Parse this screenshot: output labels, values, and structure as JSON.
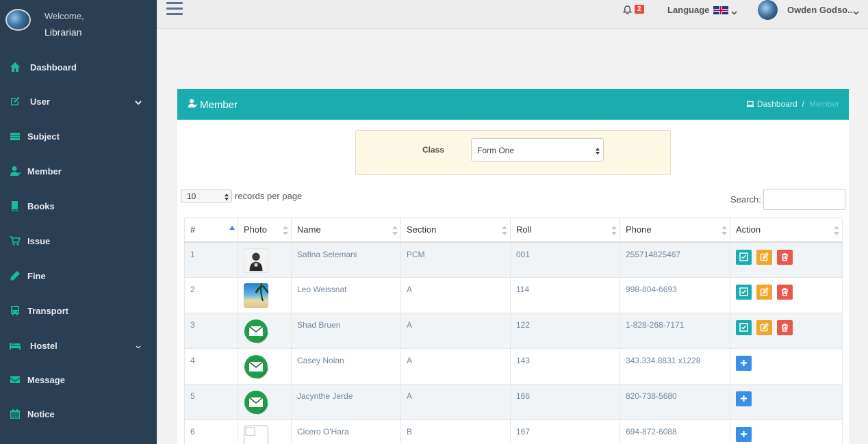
{
  "sidebar": {
    "welcome": "Welcome,",
    "role": "Librarian",
    "items": [
      {
        "label": "Dashboard",
        "icon": "home-icon"
      },
      {
        "label": "User",
        "icon": "edit-icon"
      },
      {
        "label": "Subject",
        "icon": "database-icon"
      },
      {
        "label": "Member",
        "icon": "user-icon"
      },
      {
        "label": "Books",
        "icon": "book-icon"
      },
      {
        "label": "Issue",
        "icon": "cart-icon"
      },
      {
        "label": "Fine",
        "icon": "pen-icon"
      },
      {
        "label": "Transport",
        "icon": "bus-icon"
      },
      {
        "label": "Hostel",
        "icon": "bed-icon"
      },
      {
        "label": "Message",
        "icon": "envelope-icon"
      },
      {
        "label": "Notice",
        "icon": "calendar-icon"
      }
    ]
  },
  "topbar": {
    "notification_count": "2",
    "language_label": "Language",
    "user_name": "Owden Godso.."
  },
  "panel": {
    "title": "Member",
    "breadcrumb": {
      "home": "Dashboard",
      "separator": "/",
      "current": "Member"
    },
    "filter": {
      "label": "Class",
      "selected": "Form One"
    },
    "records_per_page": {
      "value": "10",
      "label": "records per page"
    },
    "search_label": "Search:",
    "columns": [
      "#",
      "Photo",
      "Name",
      "Section",
      "Roll",
      "Phone",
      "Action"
    ],
    "rows": [
      {
        "num": "1",
        "photo": "person",
        "name": "Safina Selemani",
        "section": "PCM",
        "roll": "001",
        "phone": "255714825467",
        "actions": "full"
      },
      {
        "num": "2",
        "photo": "beach",
        "name": "Leo Weissnat",
        "section": "A",
        "roll": "114",
        "phone": "998-804-6693",
        "actions": "full"
      },
      {
        "num": "3",
        "photo": "mail",
        "name": "Shad Bruen",
        "section": "A",
        "roll": "122",
        "phone": "1-828-268-7171",
        "actions": "full"
      },
      {
        "num": "4",
        "photo": "mail",
        "name": "Casey Nolan",
        "section": "A",
        "roll": "143",
        "phone": "343.334.8831 x1228",
        "actions": "add"
      },
      {
        "num": "5",
        "photo": "mail",
        "name": "Jacynthe Jerde",
        "section": "A",
        "roll": "166",
        "phone": "820-738-5680",
        "actions": "add"
      },
      {
        "num": "6",
        "photo": "broken",
        "name": "Cicero O'Hara",
        "section": "B",
        "roll": "167",
        "phone": "694-872-6088",
        "actions": "add"
      }
    ]
  },
  "colors": {
    "sidebar": "#2a3f54",
    "accent": "#1aadb0",
    "icon_green": "#1abb9c"
  }
}
